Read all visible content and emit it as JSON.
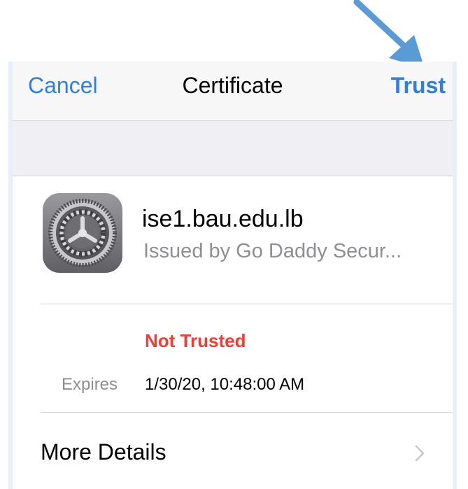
{
  "nav": {
    "cancel_label": "Cancel",
    "title": "Certificate",
    "trust_label": "Trust"
  },
  "certificate": {
    "icon": "settings-gear-icon",
    "name": "ise1.bau.edu.lb",
    "issuer": "Issued by Go Daddy Secur...",
    "status": "Not Trusted",
    "expires_label": "Expires",
    "expires_value": "1/30/20, 10:48:00 AM"
  },
  "more_details": {
    "label": "More Details",
    "chevron_icon": "chevron-right-icon"
  },
  "colors": {
    "accent": "#2f7fe0",
    "warning": "#ff3b30",
    "annotation_arrow": "#5b9bd5"
  }
}
